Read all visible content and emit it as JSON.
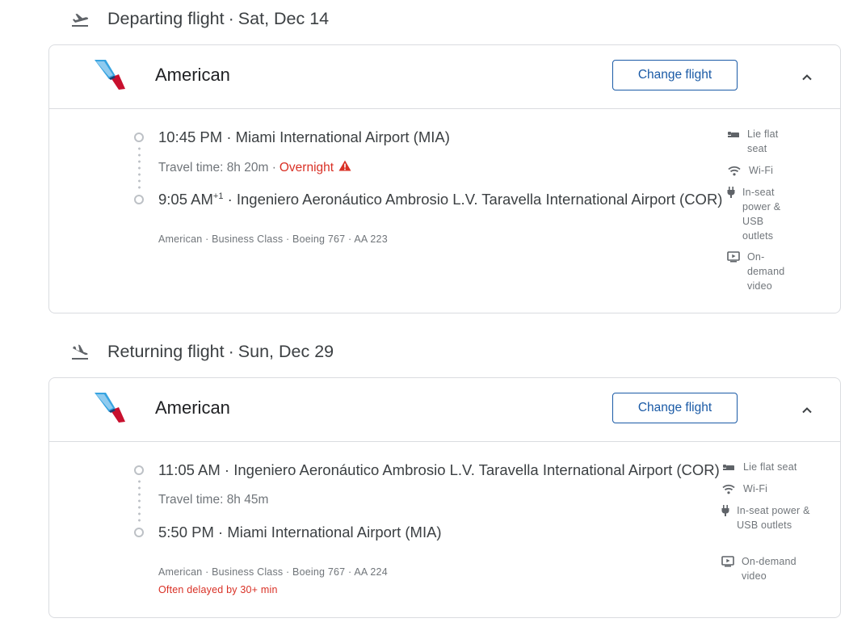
{
  "departing": {
    "title": "Departing flight",
    "sep": "·",
    "date": "Sat, Dec 14",
    "airline": "American",
    "change_label": "Change flight",
    "depart_line": "10:45 PM · Miami International Airport (MIA)",
    "travel_time": "Travel time: 8h 20m ·",
    "overnight": "Overnight",
    "arrive_time": "9:05 AM",
    "arrive_plus": "+1",
    "arrive_airport": " · Ingeniero Aeronáutico Ambrosio L.V. Taravella International Airport (COR)",
    "details": "American · Business Class · Boeing 767 · AA 223",
    "amenities": {
      "seat": "Lie flat seat",
      "wifi": "Wi-Fi",
      "power": "In-seat power & USB outlets",
      "video": "On-demand video"
    }
  },
  "returning": {
    "title": "Returning flight",
    "sep": "·",
    "date": "Sun, Dec 29",
    "airline": "American",
    "change_label": "Change flight",
    "depart_line": "11:05 AM · Ingeniero Aeronáutico Ambrosio L.V. Taravella International Airport (COR)",
    "travel_time": "Travel time: 8h 45m",
    "arrive_line": "5:50 PM · Miami International Airport (MIA)",
    "details": "American · Business Class · Boeing 767 · AA 224",
    "delay": "Often delayed by 30+ min",
    "amenities": {
      "seat": "Lie flat seat",
      "wifi": "Wi-Fi",
      "power": "In-seat power & USB outlets",
      "video": "On-demand video"
    }
  },
  "colors": {
    "accent": "#1a5aa6",
    "warning": "#d93025",
    "border": "#dadce0"
  },
  "icons": {
    "departing_header": "flight-takeoff-icon",
    "returning_header": "flight-land-icon",
    "collapse": "chevron-up-icon",
    "seat": "seat-icon",
    "wifi": "wifi-icon",
    "power": "power-plug-icon",
    "video": "video-icon"
  }
}
